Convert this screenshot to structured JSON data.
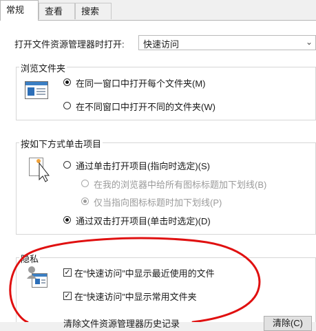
{
  "tabs": [
    "常规",
    "查看",
    "搜索"
  ],
  "open_explorer": {
    "label": "打开文件资源管理器时打开:",
    "selected": "快速访问"
  },
  "browse": {
    "title": "浏览文件夹",
    "options": [
      "在同一窗口中打开每个文件夹(M)",
      "在不同窗口中打开不同的文件夹(W)"
    ],
    "selected_index": 0
  },
  "click": {
    "title": "按如下方式单击项目",
    "single": "通过单击打开项目(指向时选定)(S)",
    "sub_options": [
      "在我的浏览器中给所有图标标题加下划线(B)",
      "仅当指向图标标题时加下划线(P)"
    ],
    "double": "通过双击打开项目(单击时选定)(D)"
  },
  "privacy": {
    "title": "隐私",
    "checkboxes": [
      "在“快速访问”中显示最近使用的文件",
      "在“快速访问”中显示常用文件夹"
    ],
    "clear_label": "清除文件资源管理器历史记录",
    "clear_button": "清除(C)"
  },
  "colors": {
    "annotation": "#e01010",
    "border": "#d6d6d6"
  }
}
